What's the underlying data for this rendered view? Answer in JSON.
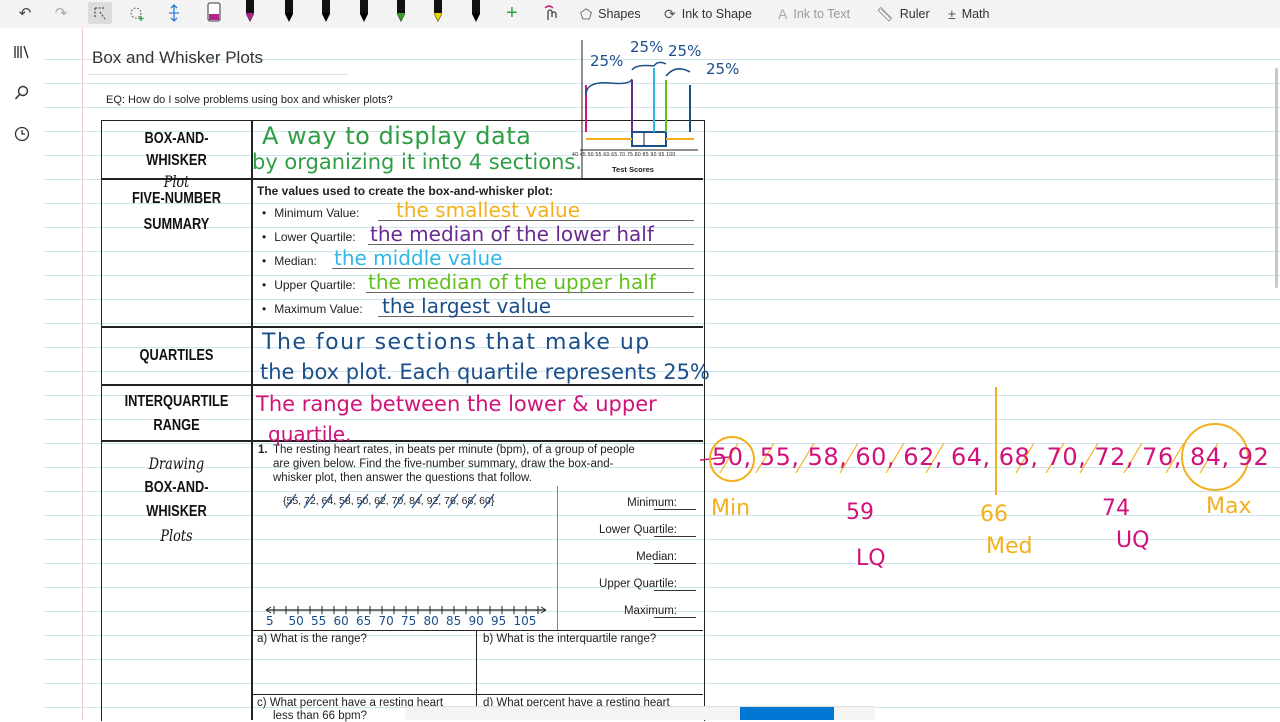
{
  "toolbar": {
    "shapes_label": "Shapes",
    "ink_to_shape_label": "Ink to Shape",
    "ink_to_text_label": "Ink to Text",
    "ruler_label": "Ruler",
    "math_label": "Math",
    "pen_colors": [
      "#2b2b2b",
      "#b0258c",
      "#000000",
      "#000000",
      "#000000",
      "#3c9d2b",
      "#f2d400",
      "#000000",
      "#c81e1e",
      "#000000"
    ]
  },
  "page": {
    "title": "Box and Whisker Plots",
    "eq": "EQ: How do I solve problems using box and whisker plots?"
  },
  "worksheet": {
    "row1_label_a": "BOX-AND-WHISKER",
    "row1_label_b": "Plot",
    "row1_ink_a": "A way to display data",
    "row1_ink_b": "by organizing it into 4 sections.",
    "mini_plot_caption": "Test Scores",
    "mini_plot_ticks": "40 45 50 55 60 65 70 75 80 85 90 95 100",
    "pct_labels": [
      "25%",
      "25%",
      "25%",
      "25%"
    ],
    "row2_label_a": "FIVE-NUMBER",
    "row2_label_b": "SUMMARY",
    "row2_heading": "The values used to create the box-and-whisker plot:",
    "summary_items": [
      {
        "label": "Minimum Value:",
        "ink": "the smallest value"
      },
      {
        "label": "Lower Quartile:",
        "ink": "the median of the lower half"
      },
      {
        "label": "Median:",
        "ink": "the middle value"
      },
      {
        "label": "Upper Quartile:",
        "ink": "the median of the upper half"
      },
      {
        "label": "Maximum Value:",
        "ink": "the largest value"
      }
    ],
    "row3_label": "QUARTILES",
    "row3_ink_a": "The four sections that make up",
    "row3_ink_b": "the box plot. Each quartile represents 25%",
    "row4_label_a": "INTERQUARTILE",
    "row4_label_b": "RANGE",
    "row4_ink_a": "The range between the lower & upper",
    "row4_ink_b": "quartile.",
    "row5_label_a": "Drawing",
    "row5_label_b": "BOX-AND-WHISKER",
    "row5_label_c": "Plots",
    "problem_num": "1.",
    "problem_text_a": "The resting heart rates, in beats per minute (bpm), of a group of people",
    "problem_text_b": "are given below. Find the five-number summary, draw the box-and-",
    "problem_text_c": "whisker plot, then answer the questions that follow.",
    "data_set": "{55, 72, 64, 58, 50, 62, 70, 84, 92, 76, 68, 60}",
    "fs_fields": [
      "Minimum:",
      "Lower Quartile:",
      "Median:",
      "Upper Quartile:",
      "Maximum:"
    ],
    "number_line": [
      "5",
      "50",
      "55",
      "60",
      "65",
      "70",
      "75",
      "80",
      "85",
      "90",
      "95",
      "105"
    ],
    "q_a": "a) What is the range?",
    "q_b": "b) What is the interquartile range?",
    "q_c_a": "c) What percent have a resting heart",
    "q_c_b": "less than 66 bpm?",
    "q_d": "d) What percent have a resting heart"
  },
  "side_ink": {
    "sorted": "50, 55, 58, 60, 62, 64, 68, 70, 72, 76, 84, 92",
    "min": "Min",
    "lq_value": "59",
    "lq": "LQ",
    "med_value": "66",
    "med": "Med",
    "uq_value": "74",
    "uq": "UQ",
    "max": "Max"
  },
  "ink_colors": {
    "green": "#2e9e44",
    "orange": "#f2b01e",
    "purple": "#6a2a8f",
    "cyan": "#2fb7e6",
    "lime": "#63c11e",
    "navy": "#1a4f8a",
    "magenta": "#d1127a"
  }
}
